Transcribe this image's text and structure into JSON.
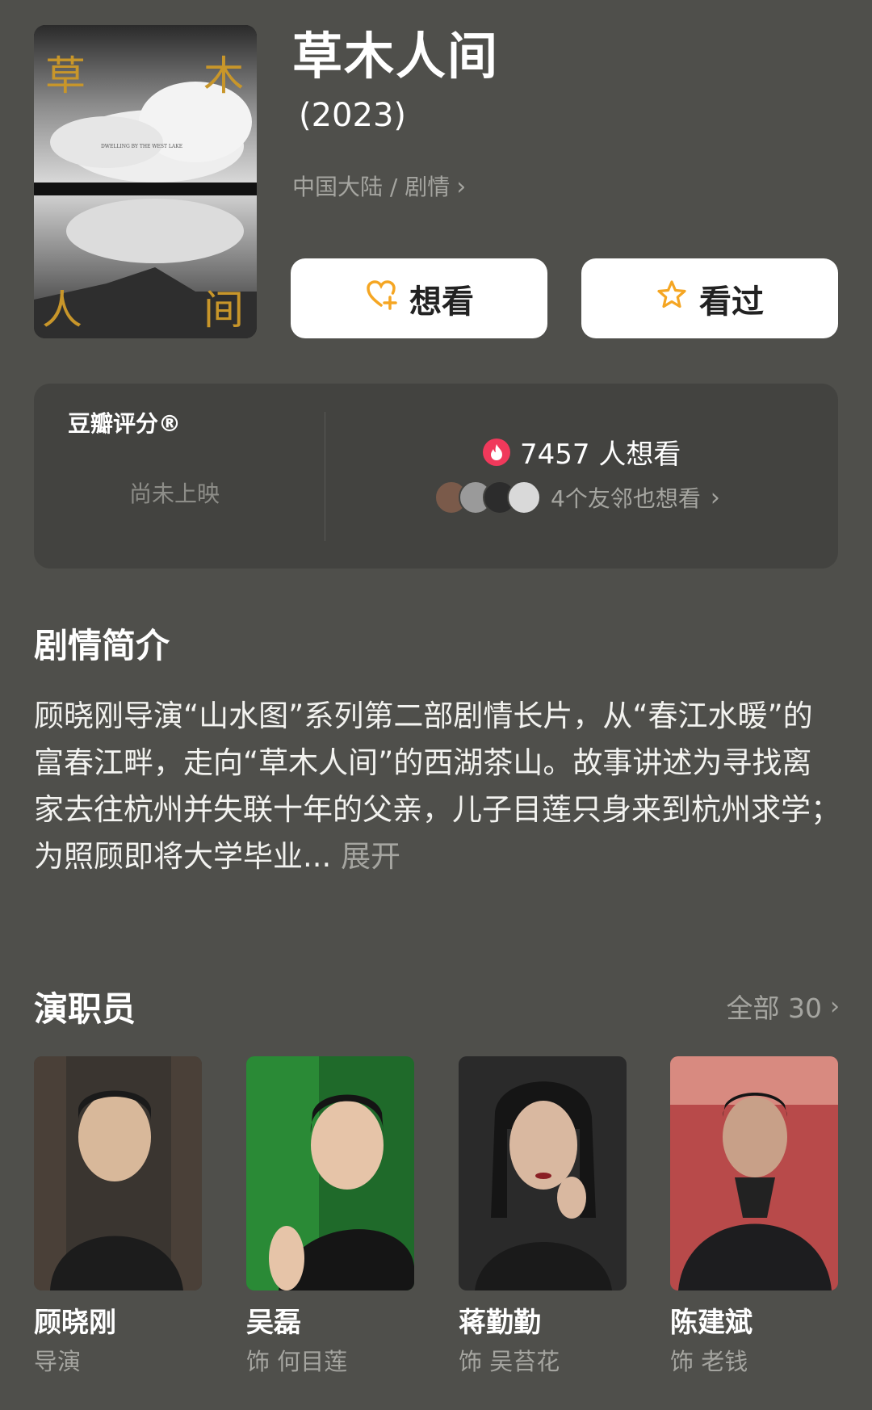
{
  "movie": {
    "title": "草木人间",
    "year": "(2023)",
    "genre": "中国大陆 / 剧情"
  },
  "poster": {
    "chars": [
      "草",
      "木",
      "人",
      "间"
    ],
    "tagline": "DWELLING BY THE WEST LAKE"
  },
  "actions": {
    "want_label": "想看",
    "seen_label": "看过"
  },
  "rating": {
    "label": "豆瓣评分®",
    "status": "尚未上映",
    "want_count": "7457 人想看",
    "friends_text": "4个友邻也想看"
  },
  "synopsis": {
    "title": "剧情简介",
    "text": "顾晓刚导演“山水图”系列第二部剧情长片，从“春江水暖”的富春江畔，走向“草木人间”的西湖茶山。故事讲述为寻找离家去往杭州并失联十年的父亲，儿子目莲只身来到杭州求学；为照顾即将大学毕业...",
    "expand_label": "展开"
  },
  "cast": {
    "title": "演职员",
    "see_all": "全部 30",
    "members": [
      {
        "name": "顾晓刚",
        "role": "导演"
      },
      {
        "name": "吴磊",
        "role": "饰 何目莲"
      },
      {
        "name": "蒋勤勤",
        "role": "饰 吴苔花"
      },
      {
        "name": "陈建斌",
        "role": "饰 老钱"
      }
    ]
  },
  "colors": {
    "background": "#4f4f4b",
    "card": "#434340",
    "accent_orange": "#f5a623",
    "fire_red": "#f0395b"
  }
}
